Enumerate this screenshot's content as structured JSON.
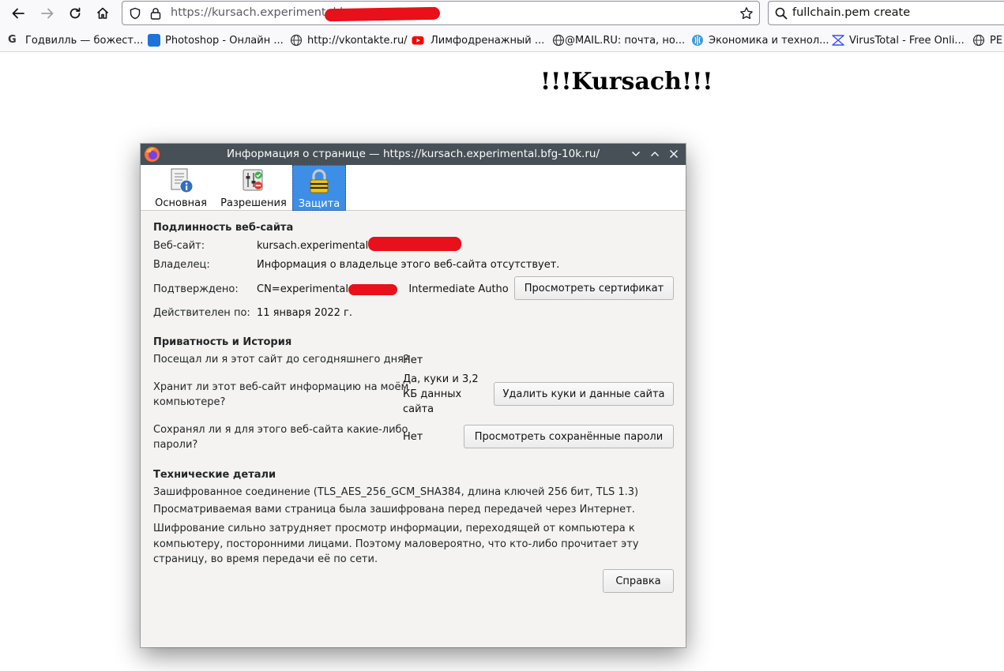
{
  "browser": {
    "url_text": "https://kursach.experimental.",
    "url_tail": "b",
    "search_query": "fullchain.pem create"
  },
  "bookmarks": [
    {
      "label": "Годвилль — божест...",
      "icon": "godville-icon"
    },
    {
      "label": "Photoshop - Онлайн ...",
      "icon": "photoshop-icon"
    },
    {
      "label": "http://vkontakte.ru/",
      "icon": "globe-icon"
    },
    {
      "label": "Лимфодренажный ...",
      "icon": "youtube-icon"
    },
    {
      "label": "@MAIL.RU: почта, но...",
      "icon": "globe-icon"
    },
    {
      "label": "Экономика и технол...",
      "icon": "site-icon"
    },
    {
      "label": "VirusTotal - Free Onli...",
      "icon": "virustotal-icon"
    },
    {
      "label": "PE",
      "icon": "globe-icon"
    }
  ],
  "page": {
    "heading": "!!!Kursach!!!"
  },
  "dialog": {
    "title": "Информация о странице — https://kursach.experimental.bfg-10k.ru/",
    "tabs": [
      {
        "label": "Основная",
        "icon": "info-document-icon"
      },
      {
        "label": "Разрешения",
        "icon": "permissions-icon"
      },
      {
        "label": "Защита",
        "icon": "padlock-icon"
      }
    ],
    "identity": {
      "heading": "Подлинность веб-сайта",
      "website_label": "Веб-сайт:",
      "website_value": "kursach.experimental.",
      "owner_label": "Владелец:",
      "owner_value": "Информация о владельце этого веб-сайта отсутствует.",
      "verified_label": "Подтверждено:",
      "verified_value_pre": "CN=experimental.b",
      "verified_value_post": "Intermediate Authorit",
      "view_cert_button": "Просмотреть сертификат",
      "valid_label": "Действителен по:",
      "valid_value": "11 января 2022 г."
    },
    "privacy": {
      "heading": "Приватность и История",
      "visited_q": "Посещал ли я этот сайт до сегодняшнего дня?",
      "visited_a": "Нет",
      "storage_q_line1": "Хранит ли этот веб-сайт информацию на моём",
      "storage_q_line2": "компьютере?",
      "storage_a_line1": "Да, куки и 3,2",
      "storage_a_line2": "КБ данных",
      "storage_a_line3": "сайта",
      "clear_button": "Удалить куки и данные сайта",
      "passwords_q_line1": "Сохранял ли я для этого веб-сайта какие-либо",
      "passwords_q_line2": "пароли?",
      "passwords_a": "Нет",
      "passwords_button": "Просмотреть сохранённые пароли"
    },
    "technical": {
      "heading": "Технические детали",
      "line1": "Зашифрованное соединение (TLS_AES_256_GCM_SHA384, длина ключей 256 бит, TLS 1.3)",
      "line2": "Просматриваемая вами страница была зашифрована перед передачей через Интернет.",
      "line3": "Шифрование сильно затрудняет просмотр информации, переходящей от компьютера к компьютеру, посторонними лицами. Поэтому маловероятно, что кто-либо прочитает эту страницу, во время передачи её по сети."
    },
    "help_button": "Справка"
  }
}
